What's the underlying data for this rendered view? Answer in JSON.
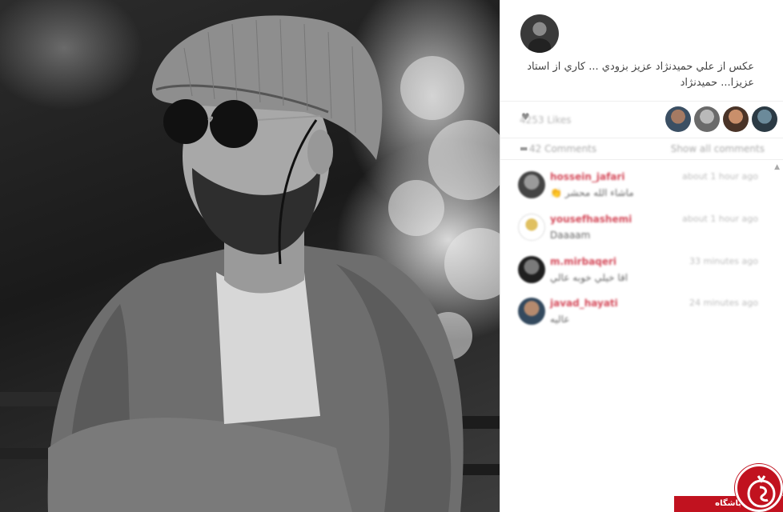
{
  "post": {
    "caption": "عكس از علي حميدنژاد عزيز بزودي ... كاري از استاد عزيزا... حميدنژاد",
    "likes_text": "4253 Likes",
    "comments_text": "42 Comments",
    "show_all": "Show all comments"
  },
  "comments": [
    {
      "user": "hossein_jafari",
      "text": "👏 ماشاء الله محشر",
      "time": "about 1 hour ago"
    },
    {
      "user": "yousefhashemi",
      "text": "Daaaam",
      "time": "about 1 hour ago"
    },
    {
      "user": "m.mirbaqeri",
      "text": "اقا خيلي خوبه عالي",
      "time": "33 minutes ago"
    },
    {
      "user": "javad_hayati",
      "text": "عاليه",
      "time": "24 minutes ago"
    }
  ],
  "watermark": {
    "label": "باشگاه خبرنگاران"
  },
  "colors": {
    "username": "#d44a5a",
    "watermark": "#c1121f"
  }
}
